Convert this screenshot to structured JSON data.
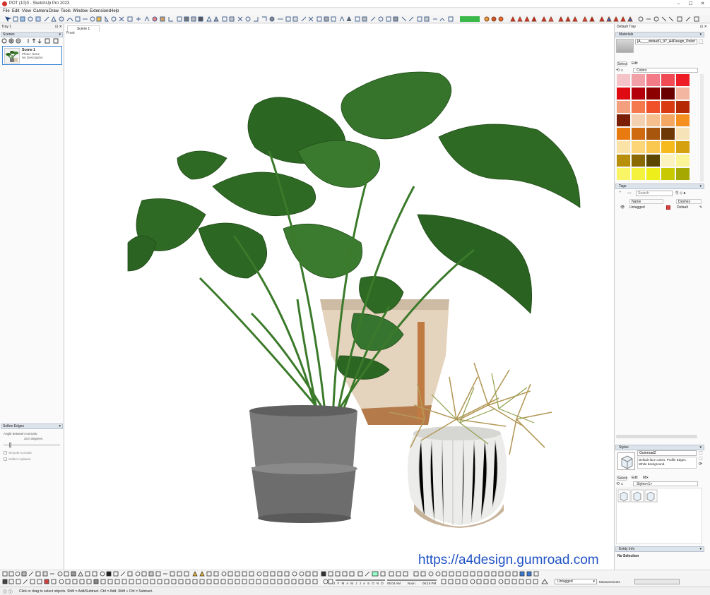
{
  "titlebar": {
    "title": "POT (10)0 - SketchUp Pro 2023"
  },
  "menu": [
    "File",
    "Edit",
    "View",
    "Camera",
    "Draw",
    "Tools",
    "Window",
    "Extensions",
    "Help"
  ],
  "left_tray": {
    "title": "Tray 1",
    "scenes_panel": "Scenes",
    "scene": {
      "name": "Scene 1",
      "photo": "Photo: None",
      "description": "No Description"
    },
    "soften_panel": {
      "title": "Soften Edges",
      "angle_label": "Angle between normals:",
      "angle_value": "20.0  degrees",
      "smooth_normals": "Smooth normals",
      "soften_coplanar": "Soften coplanar"
    }
  },
  "viewport": {
    "tab": "Scene 1",
    "view_label": "Front",
    "watermark": "https://a4design.gumroad.com"
  },
  "right_tray": {
    "title": "Default Tray",
    "materials": {
      "title": "Materials",
      "material_name": "[A____default1_97_A4Design_Polished_61",
      "tab_select": "Select",
      "tab_edit": "Edit",
      "library": "Colors",
      "swatches": [
        "#f4c4c8",
        "#f2a0a8",
        "#f27b87",
        "#f04a55",
        "#ee1c25",
        "#e00a12",
        "#b4000a",
        "#8c0000",
        "#6a0000",
        "#f3b6a0",
        "#f4a07f",
        "#f47a4e",
        "#f0502a",
        "#d93a12",
        "#b52a05",
        "#7a1e06",
        "#f3d0b0",
        "#f6bf8e",
        "#f4a763",
        "#f59020",
        "#e87a10",
        "#d06a10",
        "#a8560e",
        "#6d3706",
        "#f6e3b8",
        "#fbe2a6",
        "#fbd576",
        "#fbc84f",
        "#f6ba1c",
        "#d6a10e",
        "#b88f0a",
        "#8a6a04",
        "#5c4700",
        "#fbf2bd",
        "#fbf596",
        "#f8f466",
        "#f4f23c",
        "#eeee1a",
        "#c9c900",
        "#a4a800"
      ]
    },
    "tags": {
      "title": "Tags",
      "search_placeholder": "Search",
      "col_name": "Name",
      "col_dashes": "Dashes",
      "row": {
        "name": "Untagged",
        "dashes": "Default",
        "color": "#e04040"
      }
    },
    "styles": {
      "title": "Styles",
      "style_name": "Gumroad2",
      "description": "Default face colors. Profile Edges. White background.",
      "tab_select": "Select",
      "tab_edit": "Edit",
      "tab_mix": "Mix",
      "library": "Styles<1>"
    },
    "entity_info": {
      "title": "Entity Info",
      "selection": "No Selection"
    }
  },
  "bottom_toolbar": {
    "months": "J F M A M J J A S O N D",
    "time_start": "06:04 AM",
    "time_mid": "Noon",
    "time_end": "06:10 PM",
    "tag_select": "Untagged",
    "measurements_label": "Measurements"
  },
  "status": {
    "hint": "Click or drag to select objects. Shift = Add/Subtract. Ctrl = Add. Shift + Ctrl = Subtract."
  }
}
